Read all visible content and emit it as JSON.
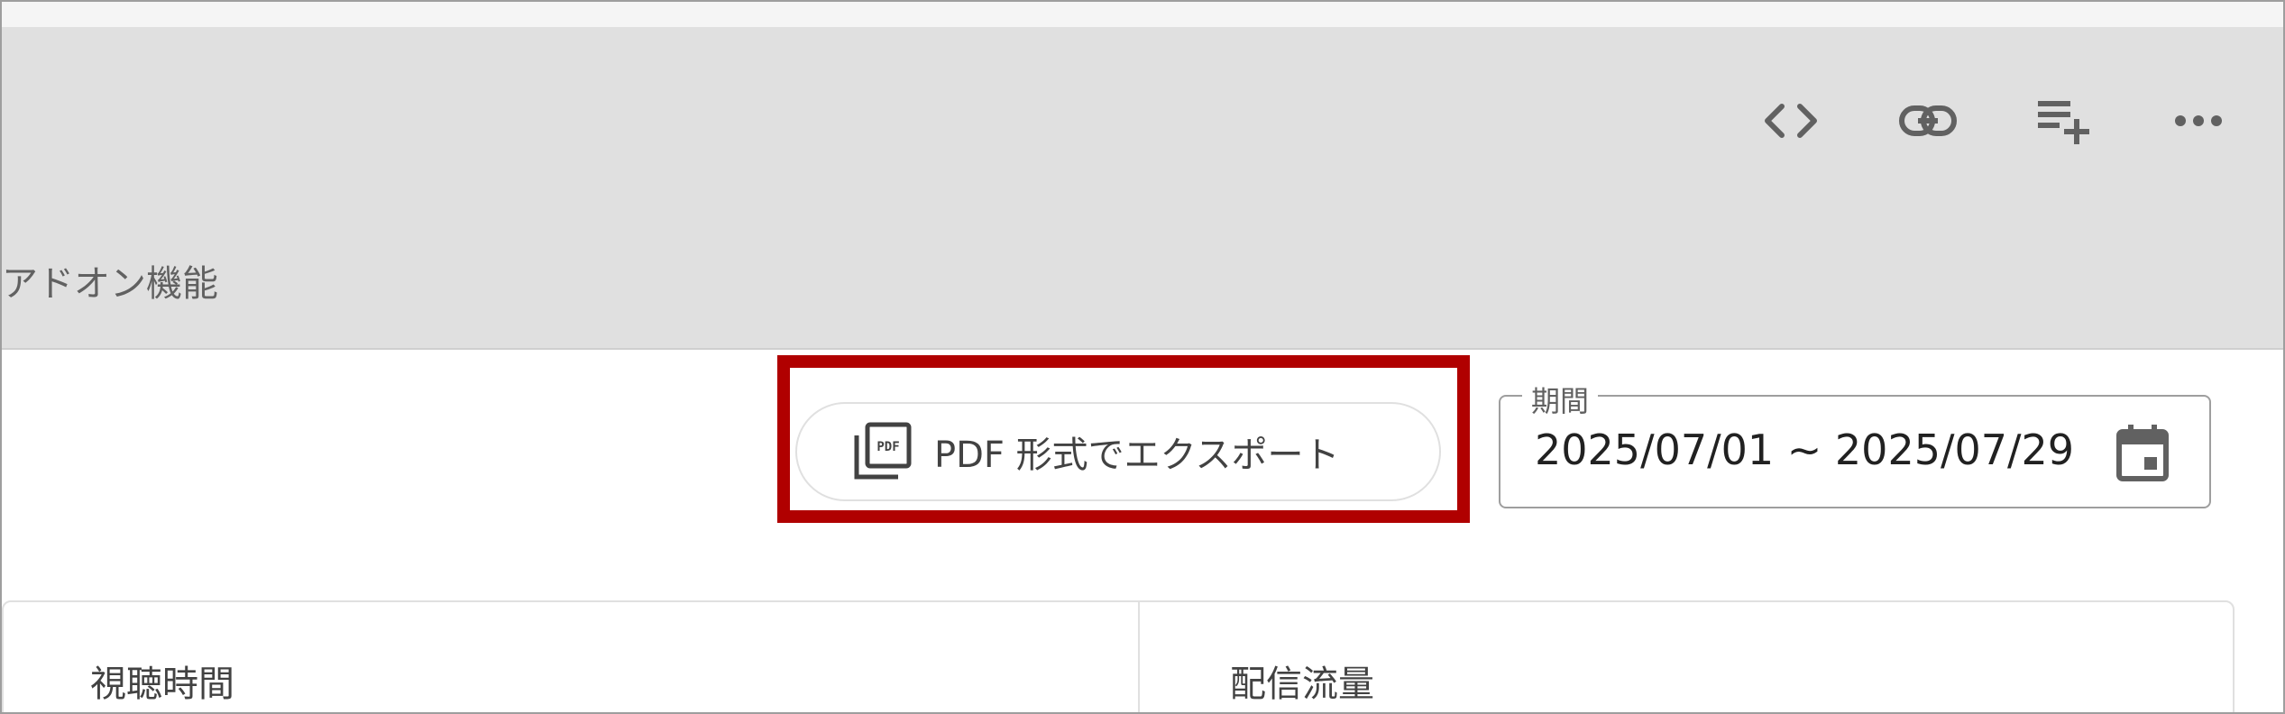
{
  "header": {
    "addon_tab_label": "アドオン機能",
    "toolbar_icons": [
      "code-icon",
      "link-icon",
      "playlist-add-icon",
      "more-horizontal-icon"
    ]
  },
  "actions": {
    "export_pdf_label": "PDF 形式でエクスポート",
    "export_pdf_icon": "pdf-icon"
  },
  "date_range": {
    "legend": "期間",
    "value": "2025/07/01 ~ 2025/07/29",
    "icon": "calendar-icon"
  },
  "cards": [
    {
      "title": "視聴時間"
    },
    {
      "title": "配信流量"
    }
  ],
  "colors": {
    "header_background": "#e0e0e0",
    "highlight_border": "#b00000",
    "icon_color": "#616161"
  }
}
